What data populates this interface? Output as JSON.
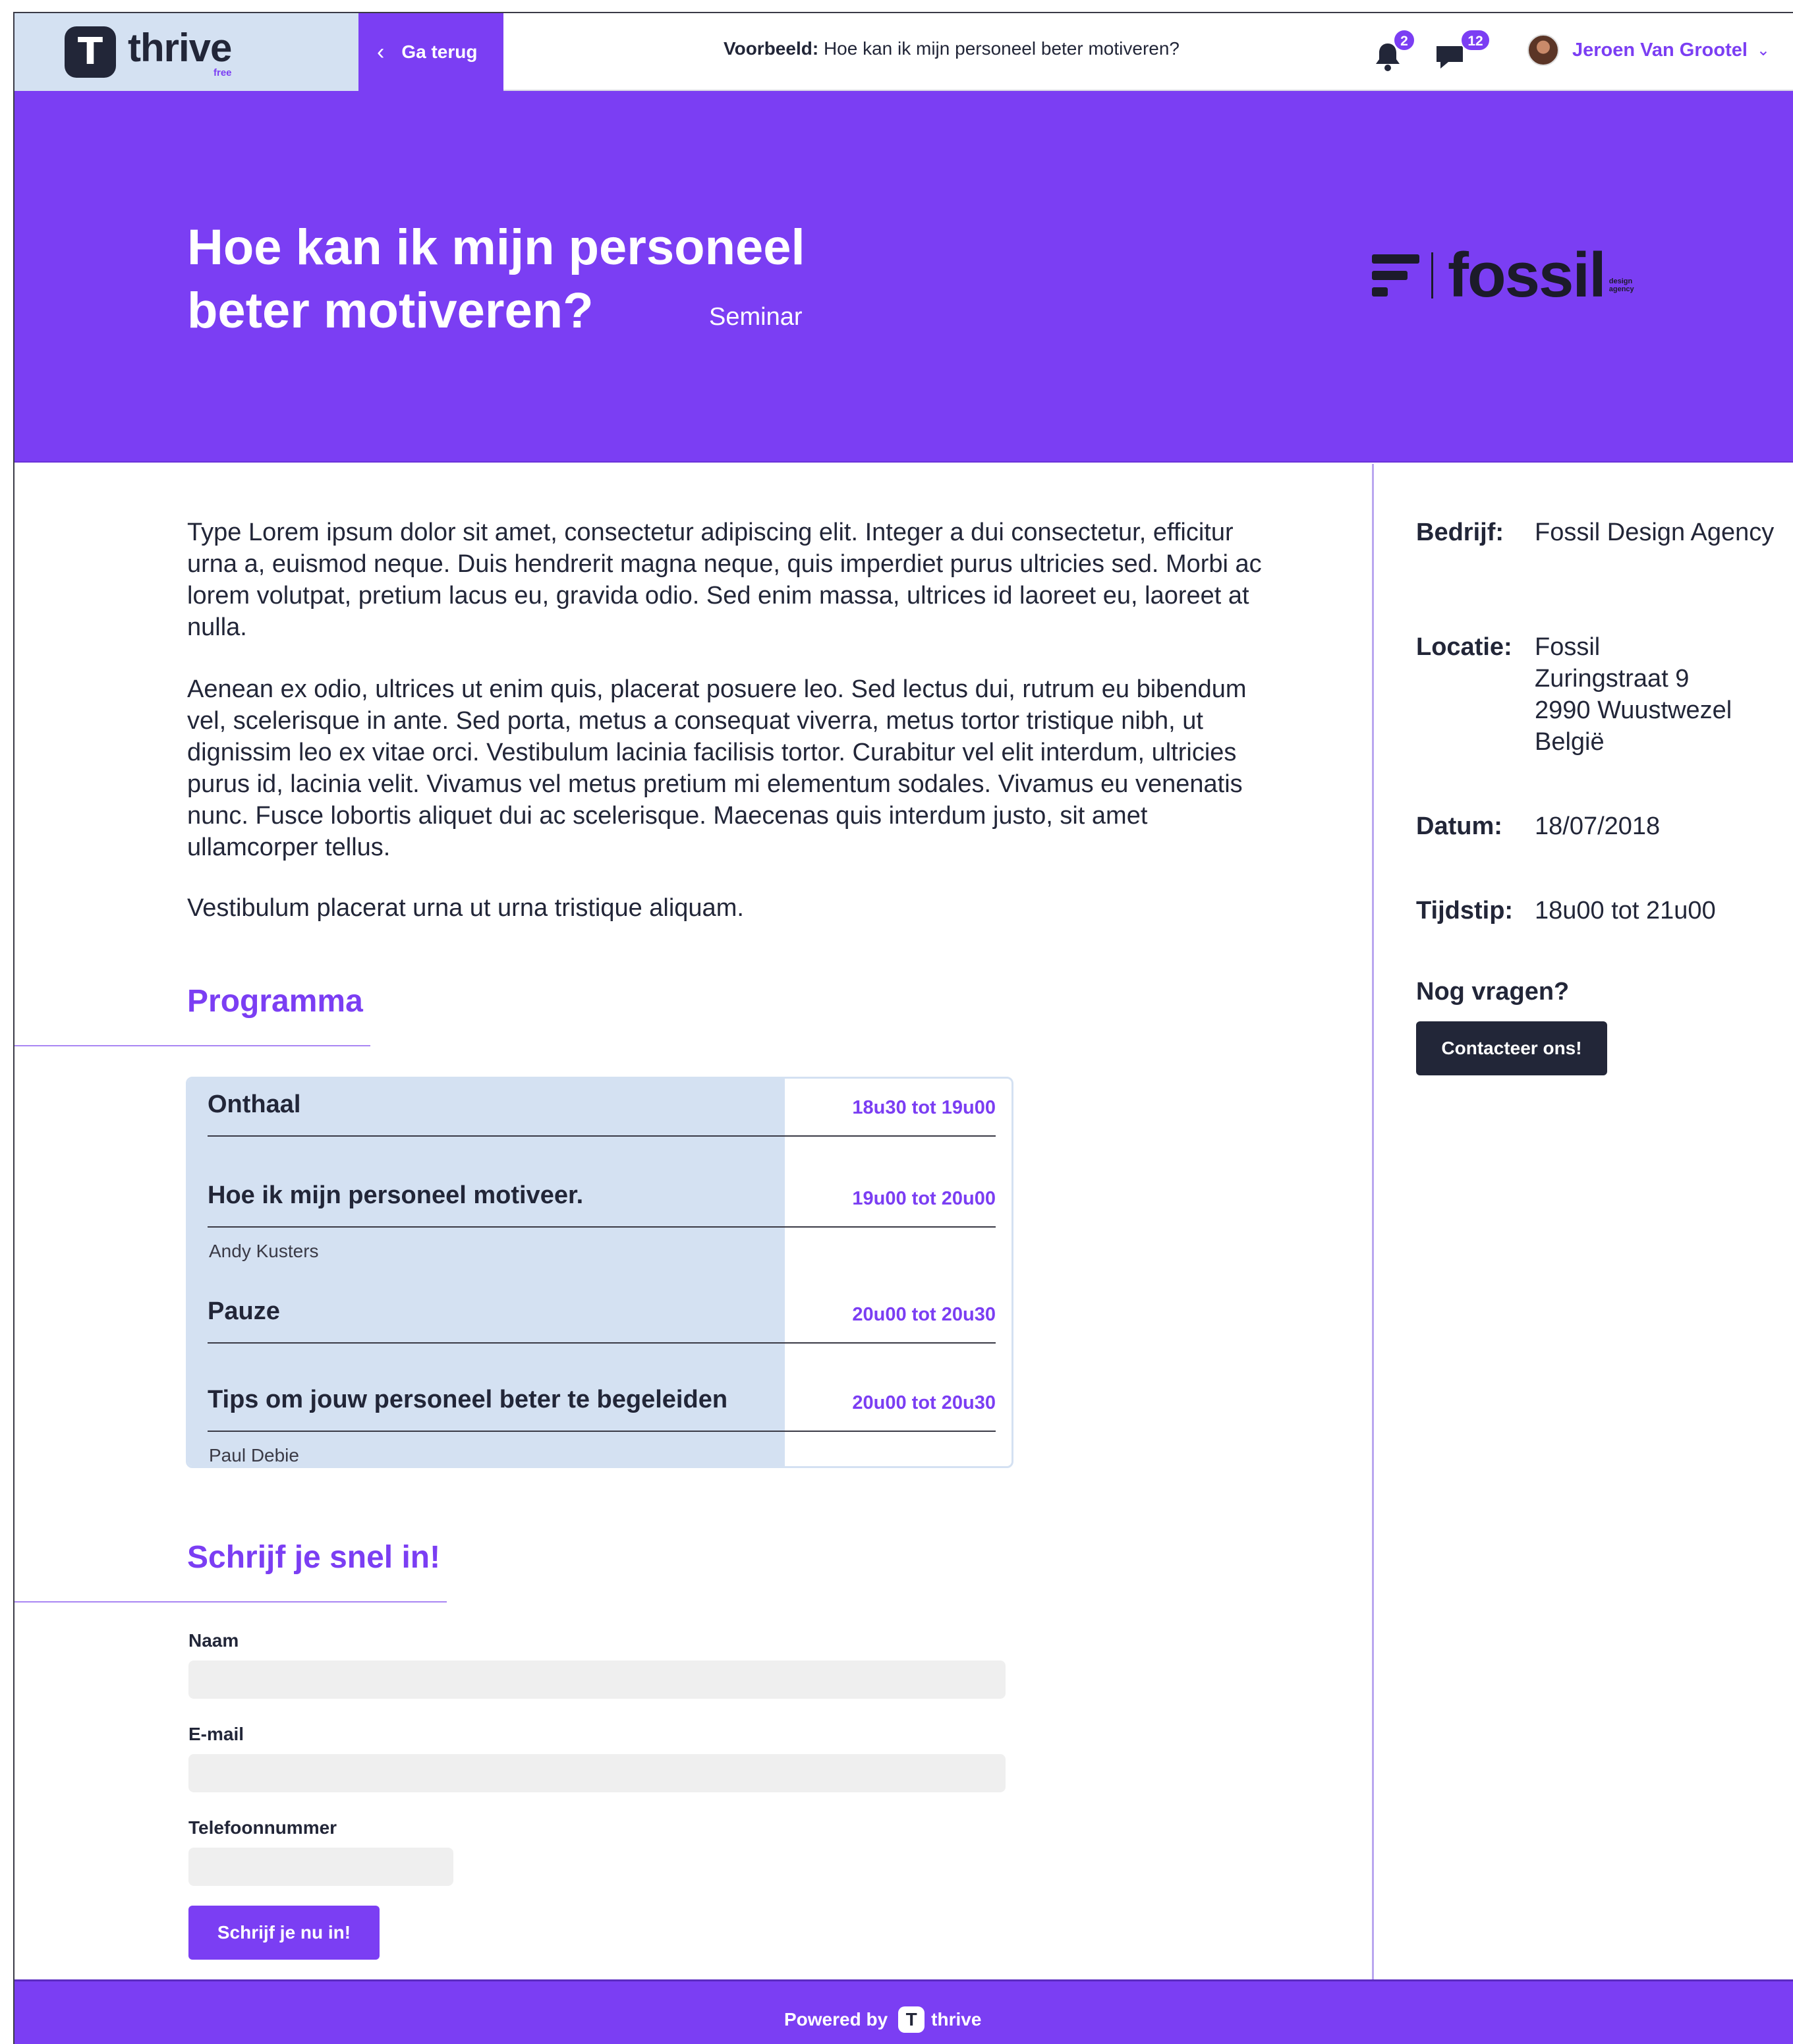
{
  "app": {
    "logo_letter": "T",
    "name": "thrive",
    "tier": "free"
  },
  "header": {
    "back_label": "Ga terug",
    "preview_prefix": "Voorbeeld:",
    "preview_title": "Hoe kan ik mijn personeel beter motiveren?",
    "notifications_count": "2",
    "messages_count": "12",
    "user_name": "Jeroen Van Grootel"
  },
  "hero": {
    "title": "Hoe kan ik mijn personeel beter motiveren?",
    "type": "Seminar",
    "company_logo_word": "fossil",
    "company_logo_sub": "design agency"
  },
  "description": {
    "p1": "Type Lorem ipsum dolor sit amet, consectetur adipiscing elit. Integer a dui consectetur, efficitur urna a, euismod neque. Duis hendrerit magna neque, quis imperdiet purus ultricies sed. Morbi ac lorem volutpat, pretium lacus eu, gravida odio. Sed enim massa, ultrices id laoreet eu, laoreet at nulla.",
    "p2": "Aenean ex odio, ultrices ut enim quis, placerat posuere leo. Sed lectus dui, rutrum eu bibendum vel, scelerisque in ante. Sed porta, metus a consequat viverra, metus tortor tristique nibh, ut dignissim leo ex vitae orci. Vestibulum lacinia facilisis tortor. Curabitur vel elit interdum, ultricies purus id, lacinia velit. Vivamus vel metus pretium mi elementum sodales. Vivamus eu venenatis nunc. Fusce lobortis aliquet dui ac scelerisque. Maecenas quis interdum justo, sit amet ullamcorper tellus.",
    "p3": "Vestibulum placerat urna ut urna tristique aliquam."
  },
  "programma": {
    "title": "Programma",
    "items": [
      {
        "title": "Onthaal",
        "time": "18u30 tot 19u00",
        "speaker": ""
      },
      {
        "title": "Hoe ik mijn personeel motiveer.",
        "time": "19u00 tot 20u00",
        "speaker": "Andy Kusters"
      },
      {
        "title": "Pauze",
        "time": "20u00 tot 20u30",
        "speaker": ""
      },
      {
        "title": "Tips om jouw personeel beter te begeleiden",
        "time": "20u00 tot 20u30",
        "speaker": "Paul Debie"
      }
    ]
  },
  "signup": {
    "title": "Schrijf je snel in!",
    "name_label": "Naam",
    "email_label": "E-mail",
    "phone_label": "Telefoonnummer",
    "name_value": "",
    "email_value": "",
    "phone_value": "",
    "submit_label": "Schrijf je nu in!"
  },
  "details": {
    "company_key": "Bedrijf:",
    "company_val": "Fossil Design Agency",
    "location_key": "Locatie:",
    "location_lines": [
      "Fossil",
      "Zuringstraat 9",
      "2990 Wuustwezel",
      "België"
    ],
    "date_key": "Datum:",
    "date_val": "18/07/2018",
    "time_key": "Tijdstip:",
    "time_val": "18u00 tot 21u00",
    "questions": "Nog vragen?",
    "contact_label": "Contacteer ons!"
  },
  "footer": {
    "powered_by": "Powered by",
    "logo_letter": "T",
    "name": "thrive"
  },
  "colors": {
    "accent": "#7b3ef3",
    "dark": "#222638",
    "light_blue": "#d4e1f2",
    "input_bg": "#efefef"
  },
  "icons": [
    "chevron-left-icon",
    "bell-icon",
    "chat-icon",
    "chevron-down-icon"
  ]
}
